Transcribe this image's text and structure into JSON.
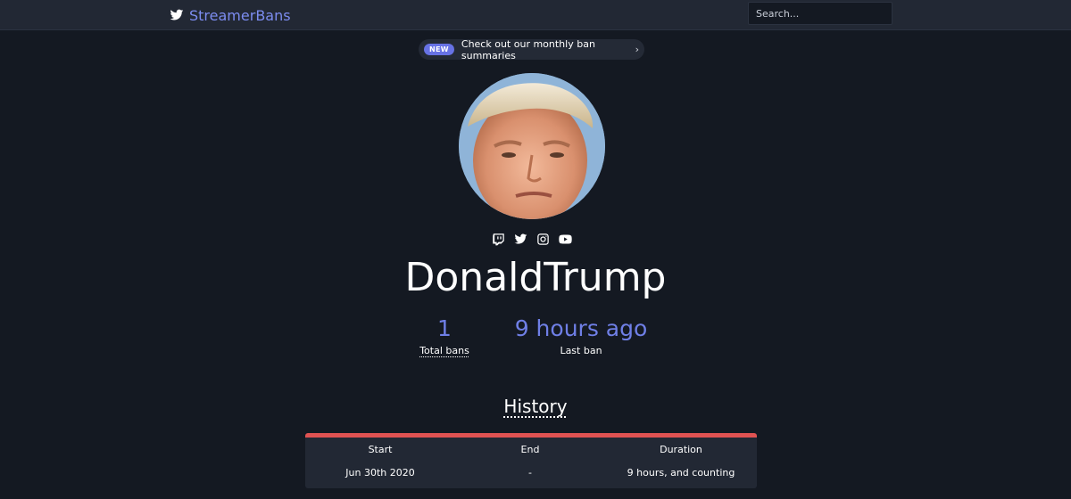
{
  "nav": {
    "brand": "StreamerBans",
    "search_placeholder": "Search..."
  },
  "announcement": {
    "badge": "NEW",
    "text": "Check out our monthly ban summaries",
    "chevron": "›"
  },
  "profile": {
    "name": "DonaldTrump",
    "socials": [
      "twitch-icon",
      "twitter-icon",
      "instagram-icon",
      "youtube-icon"
    ],
    "stats": {
      "total_bans_value": "1",
      "total_bans_label": "Total bans",
      "last_ban_value": "9 hours ago",
      "last_ban_label": "Last ban"
    }
  },
  "history": {
    "title": "History",
    "columns": [
      "Start",
      "End",
      "Duration"
    ],
    "rows": [
      [
        "Jun 30th 2020",
        "-",
        "9 hours, and counting"
      ]
    ]
  },
  "colors": {
    "accent": "#6f7fe6",
    "badge": "#6772e5",
    "ban_bar": "#e05252",
    "background": "#141922",
    "navbar": "#222834"
  }
}
